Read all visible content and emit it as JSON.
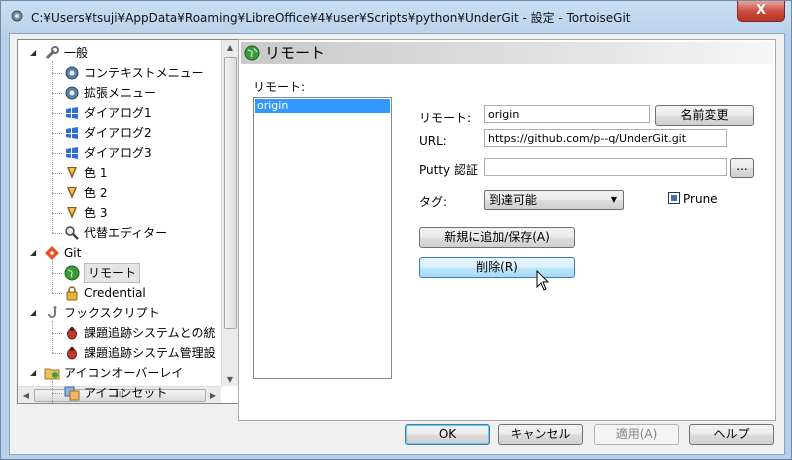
{
  "window": {
    "title": "C:¥Users¥tsuji¥AppData¥Roaming¥LibreOffice¥4¥user¥Scripts¥python¥UnderGit - 設定 - TortoiseGit",
    "close_label": "X"
  },
  "tree": {
    "items": [
      {
        "label": "一般",
        "icon": "wrench-icon",
        "level": 0,
        "expanded": true
      },
      {
        "label": "コンテキストメニュー",
        "icon": "gear-icon",
        "level": 1
      },
      {
        "label": "拡張メニュー",
        "icon": "gear-icon",
        "level": 1
      },
      {
        "label": "ダイアログ1",
        "icon": "windows-flag-icon",
        "level": 1
      },
      {
        "label": "ダイアログ2",
        "icon": "windows-flag-icon",
        "level": 1
      },
      {
        "label": "ダイアログ3",
        "icon": "windows-flag-icon",
        "level": 1
      },
      {
        "label": "色 1",
        "icon": "palette-icon",
        "level": 1
      },
      {
        "label": "色 2",
        "icon": "palette-icon",
        "level": 1
      },
      {
        "label": "色 3",
        "icon": "palette-icon",
        "level": 1
      },
      {
        "label": "代替エディター",
        "icon": "magnifier-icon",
        "level": 1
      },
      {
        "label": "Git",
        "icon": "git-icon",
        "level": 0,
        "expanded": true
      },
      {
        "label": "リモート",
        "icon": "globe-icon",
        "level": 1,
        "selected": true
      },
      {
        "label": "Credential",
        "icon": "lock-icon",
        "level": 1
      },
      {
        "label": "フックスクリプト",
        "icon": "hook-icon",
        "level": 0,
        "expanded": true
      },
      {
        "label": "課題追跡システムとの統",
        "icon": "bug-icon",
        "level": 1
      },
      {
        "label": "課題追跡システム管理設",
        "icon": "bug-icon",
        "level": 1
      },
      {
        "label": "アイコンオーバーレイ",
        "icon": "folder-icon",
        "level": 0,
        "expanded": true
      },
      {
        "label": "アイコンセット",
        "icon": "iconset-icon",
        "level": 1
      }
    ],
    "hscroll_grip": "III"
  },
  "panel": {
    "title": "リモート",
    "remote_list_label": "リモート:",
    "remotes": [
      "origin"
    ],
    "remote_field_label": "リモート:",
    "remote_value": "origin",
    "rename_button": "名前変更",
    "url_label": "URL:",
    "url_value": "https://github.com/p--q/UnderGit.git",
    "putty_label": "Putty 認証",
    "putty_value": "",
    "browse_button": "...",
    "tag_label": "タグ:",
    "tag_selected": "到達可能",
    "prune_label": "Prune",
    "add_save_button": "新規に追加/保存(A)",
    "delete_button": "削除(R)"
  },
  "footer": {
    "ok": "OK",
    "cancel": "キャンセル",
    "apply": "適用(A)",
    "help": "ヘルプ"
  }
}
